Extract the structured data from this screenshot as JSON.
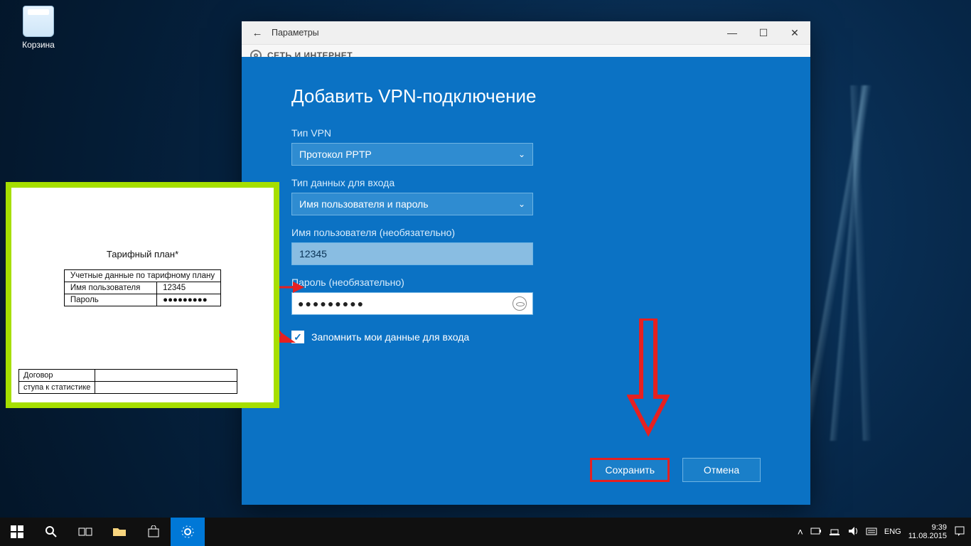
{
  "desktop": {
    "recycle_bin": "Корзина"
  },
  "window": {
    "title": "Параметры",
    "subheader": "СЕТЬ И ИНТЕРНЕТ"
  },
  "vpn": {
    "heading": "Добавить VPN-подключение",
    "type_label": "Тип VPN",
    "type_value": "Протокол PPTP",
    "auth_label": "Тип данных для входа",
    "auth_value": "Имя пользователя и пароль",
    "user_label": "Имя пользователя (необязательно)",
    "user_value": "12345",
    "pass_label": "Пароль (необязательно)",
    "pass_masked": "●●●●●●●●●",
    "remember_label": "Запомнить мои данные для входа",
    "save": "Сохранить",
    "cancel": "Отмена"
  },
  "doc": {
    "plan": "Тарифный план*",
    "cred_header": "Учетные данные по тарифному плану",
    "cred_user_label": "Имя пользователя",
    "cred_user_value": "12345",
    "cred_pass_label": "Пароль",
    "cred_pass_value": "●●●●●●●●●",
    "row1": "Договор",
    "row2": "ступа к статистике"
  },
  "taskbar": {
    "lang": "ENG",
    "time": "9:39",
    "date": "11.08.2015"
  }
}
